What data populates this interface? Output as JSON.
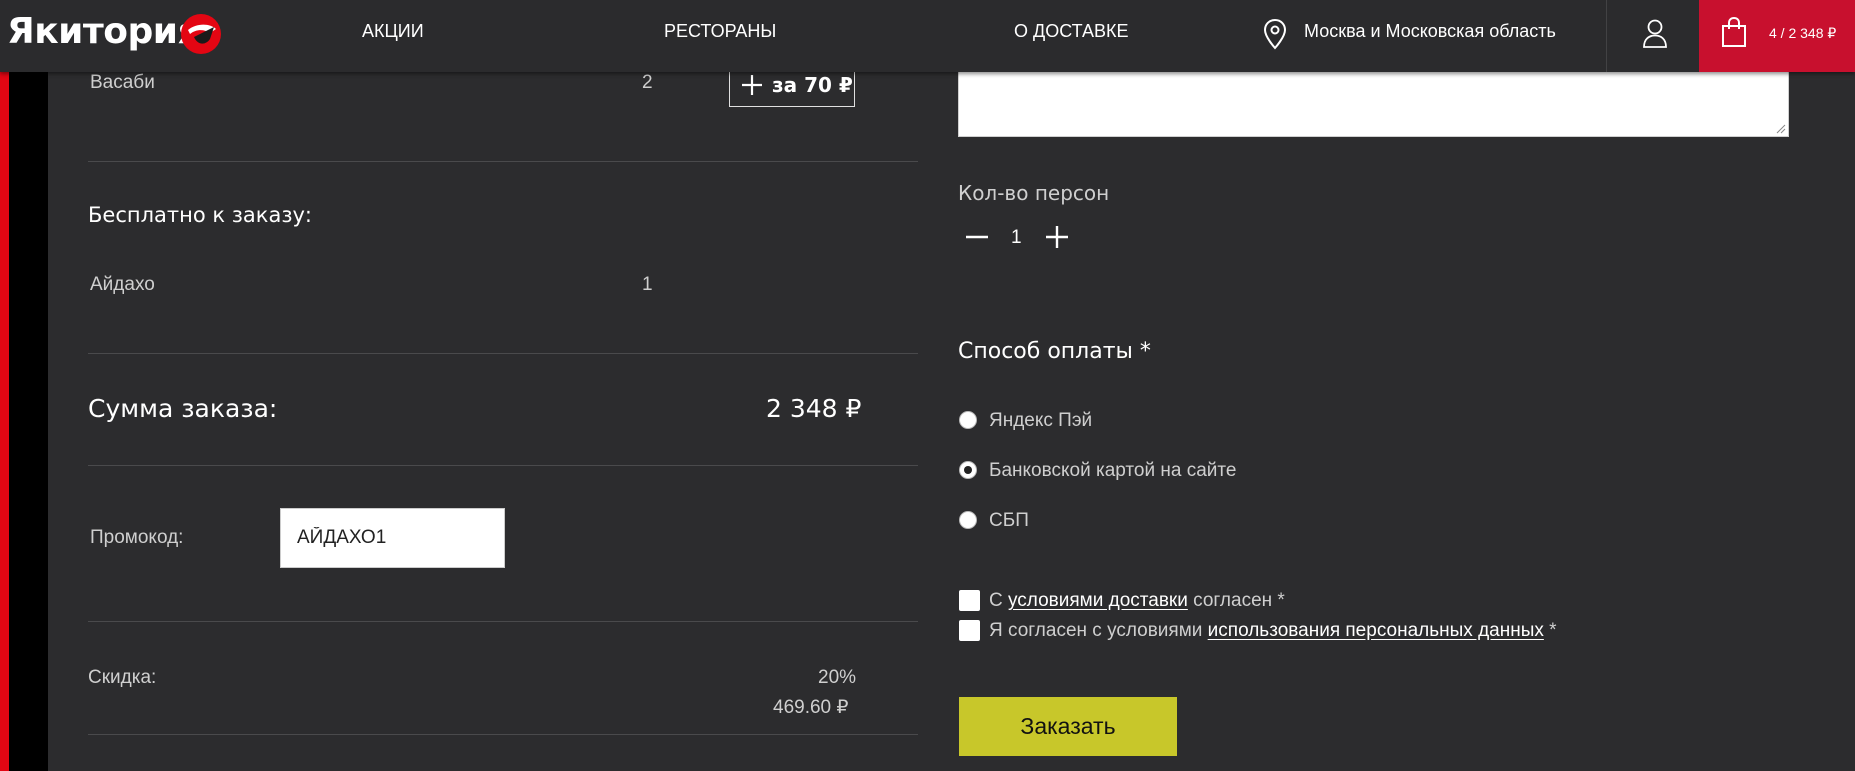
{
  "header": {
    "logo_text": "Якитория",
    "nav": [
      "АКЦИИ",
      "РЕСТОРАНЫ",
      "О ДОСТАВКЕ"
    ],
    "city": "Москва и Московская область",
    "cart": "4 / 2 348 ₽"
  },
  "order": {
    "item_name": "Васаби",
    "item_qty": "2",
    "add_button": "за 70 ₽",
    "free_heading": "Бесплатно к заказу:",
    "free_item_name": "Айдахо",
    "free_item_qty": "1",
    "total_label": "Сумма заказа:",
    "total_value": "2 348 ₽",
    "promo_label": "Промокод:",
    "promo_value": "АЙДАХО1",
    "discount_label": "Скидка:",
    "discount_percent": "20%",
    "discount_amount": "469.60 ₽"
  },
  "checkout": {
    "persons_label": "Кол-во персон",
    "persons_value": "1",
    "payment_heading": "Способ оплаты *",
    "payment_options": [
      {
        "label": "Яндекс Пэй",
        "selected": false
      },
      {
        "label": "Банковской картой на сайте",
        "selected": true
      },
      {
        "label": "СБП",
        "selected": false
      }
    ],
    "agree_delivery": {
      "prefix": "С ",
      "link": "условиями доставки",
      "suffix": " согласен *"
    },
    "agree_personal": {
      "prefix": "Я согласен с условиями ",
      "link": "использования персональных данных",
      "suffix": " *"
    },
    "submit": "Заказать"
  },
  "colors": {
    "accent_red": "#c8102e",
    "submit_yellow": "#c8c72a",
    "background": "#2c2c2e"
  },
  "icons": [
    "logo-mark-icon",
    "location-pin-icon",
    "user-icon",
    "shopping-bag-icon",
    "plus-icon",
    "minus-icon"
  ]
}
